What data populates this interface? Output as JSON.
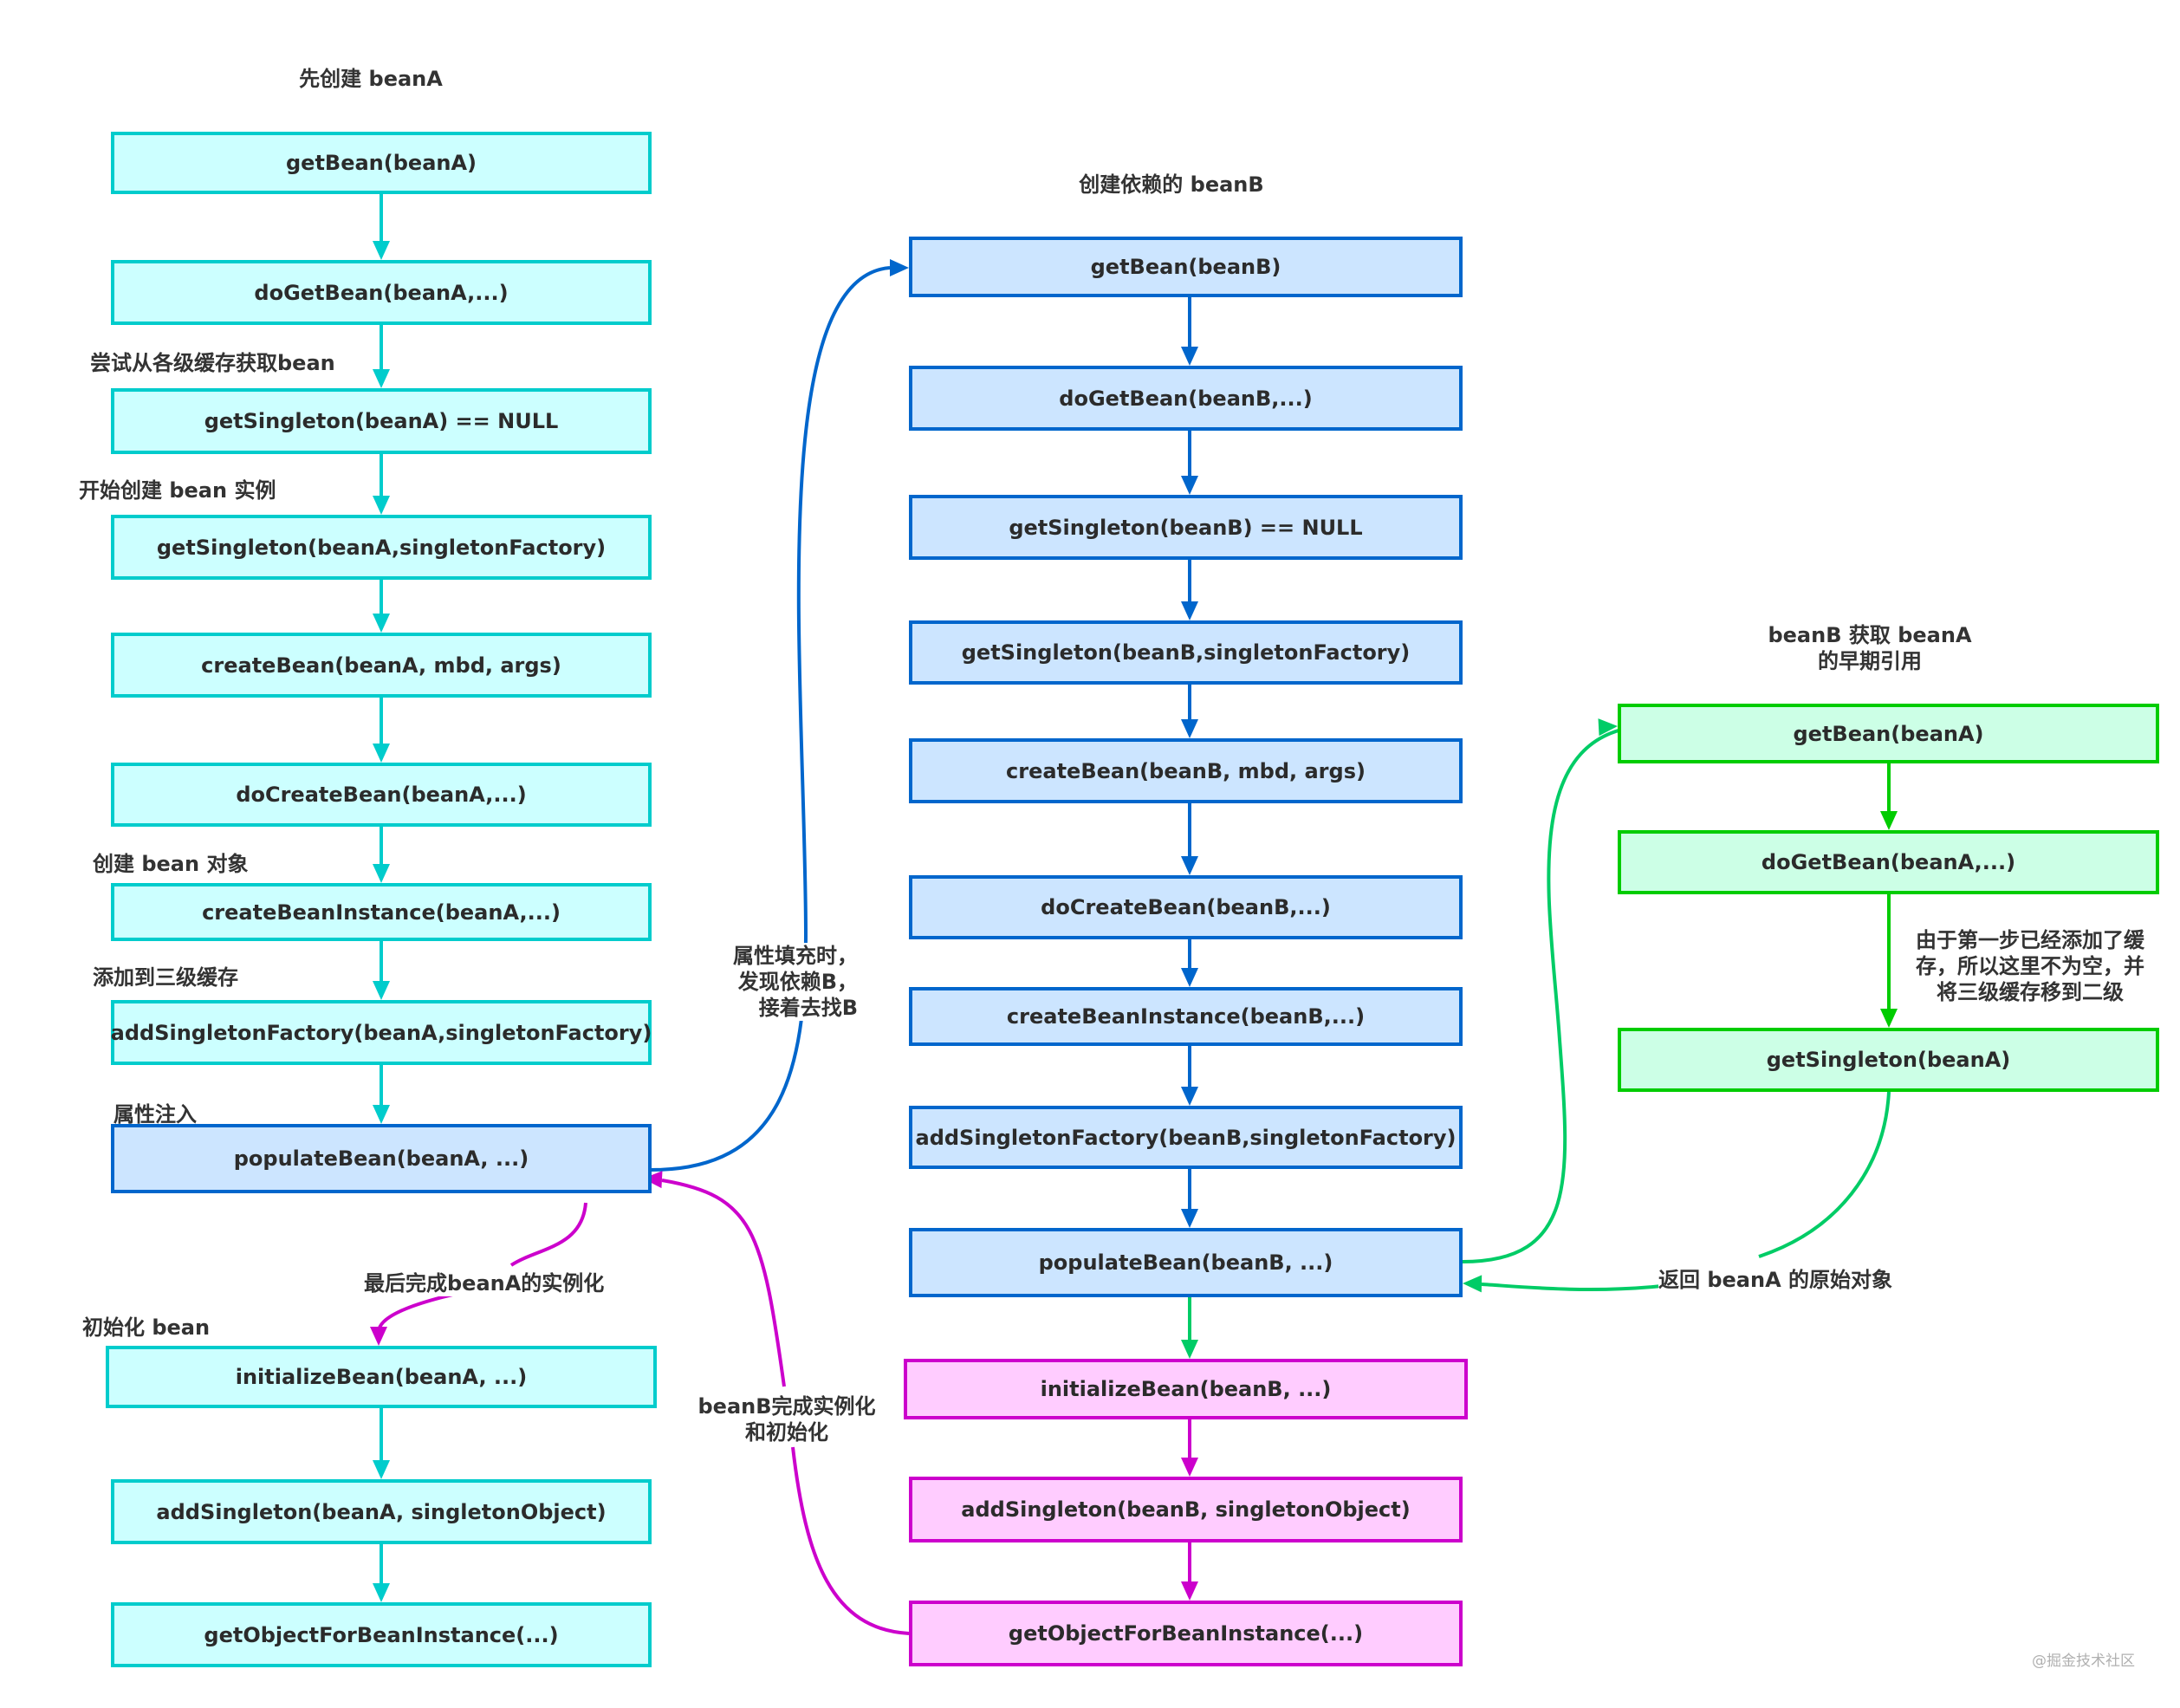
{
  "colors": {
    "cyan_fill": "#ccffff",
    "cyan_border": "#00cccc",
    "blue_fill": "#cce5ff",
    "blue_border": "#0066cc",
    "green_fill": "#ccffe6",
    "green_border": "#00cc00",
    "pink_fill": "#ffccff",
    "pink_border": "#cc00cc",
    "link_green": "#00cc66"
  },
  "columns": {
    "beanA": {
      "title": "先创建 beanA",
      "steps": [
        "getBean(beanA)",
        "doGetBean(beanA,...)",
        "getSingleton(beanA) == NULL",
        "getSingleton(beanA,singletonFactory)",
        "createBean(beanA, mbd, args)",
        "doCreateBean(beanA,...)",
        "createBeanInstance(beanA,...)",
        "addSingletonFactory(beanA,singletonFactory)",
        "populateBean(beanA, ...)",
        "initializeBean(beanA, ...)",
        "addSingleton(beanA, singletonObject)",
        "getObjectForBeanInstance(...)"
      ],
      "annotations": {
        "try_cache": "尝试从各级缓存获取bean",
        "start_create": "开始创建 bean 实例",
        "create_object": "创建 bean 对象",
        "add_third_cache": "添加到三级缓存",
        "inject": "属性注入",
        "init": "初始化 bean"
      }
    },
    "beanB": {
      "title": "创建依赖的 beanB",
      "steps": [
        "getBean(beanB)",
        "doGetBean(beanB,...)",
        "getSingleton(beanB) == NULL",
        "getSingleton(beanB,singletonFactory)",
        "createBean(beanB, mbd, args)",
        "doCreateBean(beanB,...)",
        "createBeanInstance(beanB,...)",
        "addSingletonFactory(beanB,singletonFactory)",
        "populateBean(beanB, ...)",
        "initializeBean(beanB, ...)",
        "addSingleton(beanB, singletonObject)",
        "getObjectForBeanInstance(...)"
      ]
    },
    "earlyRef": {
      "title_lines": [
        "beanB 获取 beanA",
        "的早期引用"
      ],
      "steps": [
        "getBean(beanA)",
        "doGetBean(beanA,...)",
        "getSingleton(beanA)"
      ],
      "note_lines": [
        "由于第一步已经添加了缓",
        "存，所以这里不为空，并",
        "将三级缓存移到二级"
      ]
    }
  },
  "links": {
    "to_beanB_lines": [
      "属性填充时，",
      "发现依赖B，",
      "接着去找B"
    ],
    "finish_beanA": "最后完成beanA的实例化",
    "beanB_done_lines": [
      "beanB完成实例化",
      "和初始化"
    ],
    "return_beanA": "返回 beanA 的原始对象"
  },
  "watermark": "@掘金技术社区"
}
